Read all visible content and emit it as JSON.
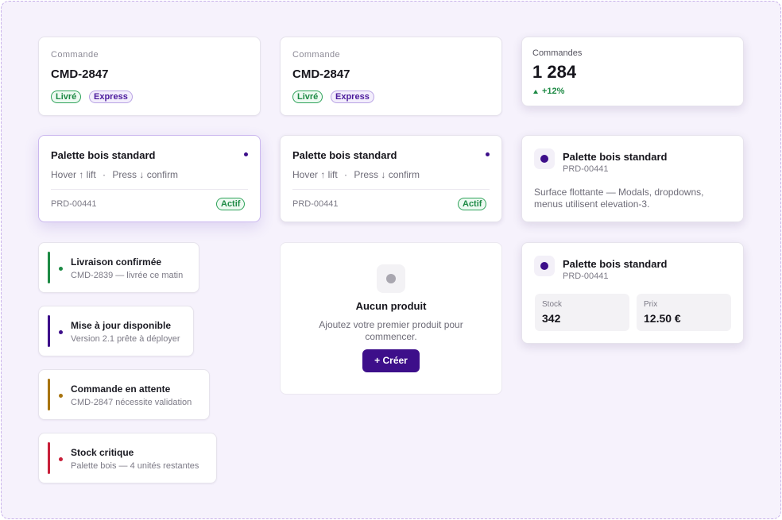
{
  "order_cards": [
    {
      "label": "Commande",
      "id": "CMD-2847",
      "badges": [
        "Livré",
        "Express"
      ]
    },
    {
      "label": "Commande",
      "id": "CMD-2847",
      "badges": [
        "Livré",
        "Express"
      ]
    }
  ],
  "metric": {
    "label": "Commandes",
    "value": "1 284",
    "delta": "+12%",
    "delta_color": "#1d8a44"
  },
  "product_cards": [
    {
      "name": "Palette bois standard",
      "hint_hover": "Hover ↑ lift",
      "hint_sep": "·",
      "hint_press": "Press ↓ confirm",
      "sku": "PRD-00441",
      "status": "Actif"
    },
    {
      "name": "Palette bois standard",
      "hint_hover": "Hover ↑ lift",
      "hint_sep": "·",
      "hint_press": "Press ↓ confirm",
      "sku": "PRD-00441",
      "status": "Actif"
    }
  ],
  "floating_card": {
    "name": "Palette bois standard",
    "sku": "PRD-00441",
    "desc_line1": "Surface flottante — Modals, dropdowns,",
    "desc_line2": "menus utilisent elevation-3."
  },
  "stats_card": {
    "name": "Palette bois standard",
    "sku": "PRD-00441",
    "stock_label": "Stock",
    "stock_value": "342",
    "price_label": "Prix",
    "price_value": "12.50 €"
  },
  "notifications": [
    {
      "title": "Livraison confirmée",
      "sub": "CMD-2839 — livrée ce matin",
      "color": "#1d8a44"
    },
    {
      "title": "Mise à jour disponible",
      "sub": "Version 2.1 prête à déployer",
      "color": "#3d0f8a"
    },
    {
      "title": "Commande en attente",
      "sub": "CMD-2847 nécessite validation",
      "color": "#a87410"
    },
    {
      "title": "Stock critique",
      "sub": "Palette bois — 4 unités restantes",
      "color": "#c8203a"
    }
  ],
  "empty_state": {
    "title": "Aucun produit",
    "line1": "Ajoutez votre premier produit pour",
    "line2": "commencer.",
    "button": "+ Créer"
  },
  "colors": {
    "accent": "#3d0f8a",
    "success": "#1d8a44",
    "warning": "#a87410",
    "danger": "#c8203a"
  }
}
